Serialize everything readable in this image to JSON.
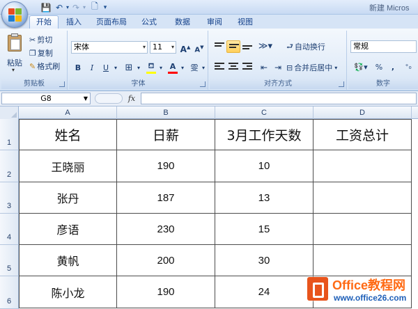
{
  "window": {
    "title": "新建 Microsoft Office Excel 工作表.xlsx - Microsoft Excel",
    "title_visible": "新建 Micros",
    "quick_access": {
      "save": "💾",
      "undo": "↶",
      "redo": "↷",
      "print_preview": "🗋",
      "customize": "▾"
    }
  },
  "tabs": [
    "开始",
    "插入",
    "页面布局",
    "公式",
    "数据",
    "审阅",
    "视图"
  ],
  "active_tab": "开始",
  "ribbon": {
    "clipboard": {
      "label": "剪贴板",
      "paste": "粘贴",
      "cut": "剪切",
      "copy": "复制",
      "format_painter": "格式刷"
    },
    "font": {
      "label": "字体",
      "font_name": "宋体",
      "font_size": "11",
      "grow": "A",
      "shrink": "A",
      "bold": "B",
      "italic": "I",
      "underline": "U",
      "font_color": "A",
      "phonetic": "雯"
    },
    "alignment": {
      "label": "对齐方式",
      "wrap_text": "自动换行",
      "merge_center": "合并后居中"
    },
    "number": {
      "label": "数字",
      "format": "常规",
      "percent": "%",
      "comma": ","
    }
  },
  "formula_bar": {
    "name_box": "G8",
    "fx": "fx",
    "formula": ""
  },
  "grid": {
    "columns": [
      "A",
      "B",
      "C",
      "D"
    ],
    "rows": [
      "1",
      "2",
      "3",
      "4",
      "5",
      "6"
    ],
    "headers": [
      "姓名",
      "日薪",
      "3月工作天数",
      "工资总计"
    ],
    "data": [
      [
        "王晓丽",
        "190",
        "10",
        ""
      ],
      [
        "张丹",
        "187",
        "13",
        ""
      ],
      [
        "彦语",
        "230",
        "15",
        ""
      ],
      [
        "黄帆",
        "200",
        "30",
        ""
      ],
      [
        "陈小龙",
        "190",
        "24",
        ""
      ]
    ]
  },
  "watermark": {
    "title": "Office教程网",
    "url": "www.office26.com",
    "color_primary": "#ff6a14",
    "color_secondary": "#1e5fb8"
  },
  "colors": {
    "ribbon_bg": "#dfeaf7",
    "accent_highlight": "#ffcf5a",
    "tab_text": "#15428b"
  }
}
